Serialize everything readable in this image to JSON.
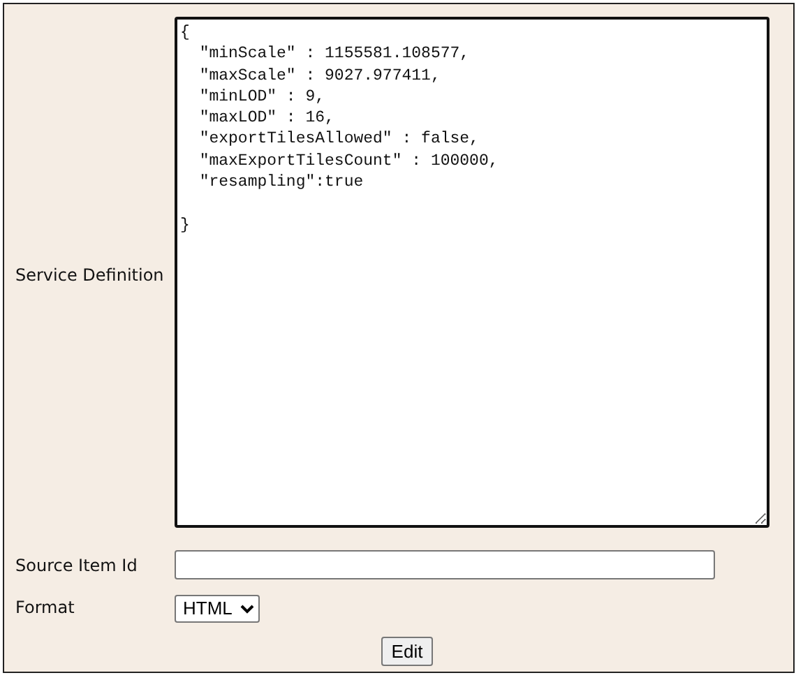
{
  "form": {
    "rows": [
      {
        "kind": "textarea",
        "label": "Service Definition",
        "value": "{\n  \"minScale\" : 1155581.108577,\n  \"maxScale\" : 9027.977411,\n  \"minLOD\" : 9,\n  \"maxLOD\" : 16,\n  \"exportTilesAllowed\" : false,\n  \"maxExportTilesCount\" : 100000,\n  \"resampling\":true\n\n}"
      },
      {
        "kind": "input",
        "label": "Source Item Id",
        "value": ""
      },
      {
        "kind": "select",
        "label": "Format",
        "value": "HTML"
      }
    ],
    "submit": "Edit"
  }
}
